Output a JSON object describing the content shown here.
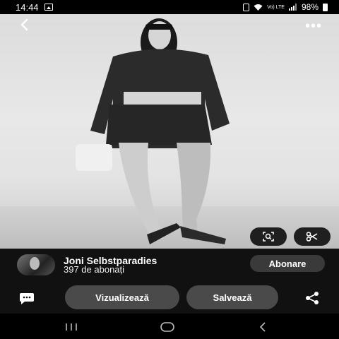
{
  "status_bar": {
    "time": "14:44",
    "network": "Vo) LTE",
    "battery": "98%"
  },
  "photo": {
    "back_icon": "back-arrow-icon",
    "more_label": "•••",
    "lens_icon": "visual-search-icon",
    "cut_icon": "scissors-icon"
  },
  "author": {
    "name": "Joni Selbstparadies",
    "followers": "397 de abonați",
    "follow_label": "Abonare"
  },
  "actions": {
    "visit_label": "Vizualizează",
    "save_label": "Salvează",
    "comment_icon": "comment-icon",
    "share_icon": "share-icon"
  },
  "nav": {
    "recent_icon": "recent-apps-icon",
    "home_icon": "home-icon",
    "back_icon": "nav-back-icon"
  }
}
